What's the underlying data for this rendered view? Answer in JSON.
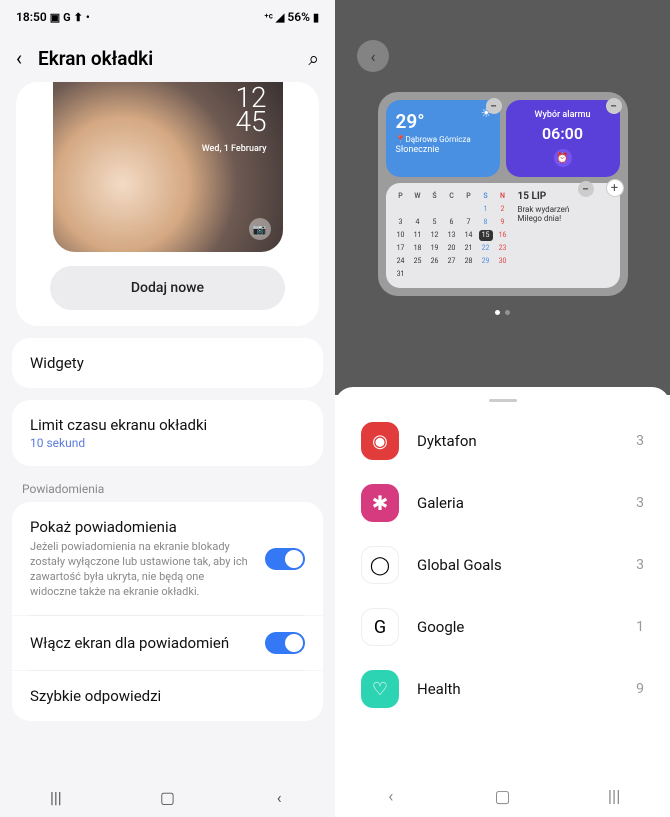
{
  "status": {
    "time": "18:50",
    "icons_left": [
      "G",
      "▲",
      "•"
    ],
    "icons_right": "56%"
  },
  "header": {
    "title": "Ekran okładki"
  },
  "cover": {
    "time1": "12",
    "time2": "45",
    "date": "Wed, 1 February"
  },
  "add_button": "Dodaj nowe",
  "rows": {
    "widgets": "Widgety",
    "timeout_title": "Limit czasu ekranu okładki",
    "timeout_sub": "10 sekund",
    "section": "Powiadomienia",
    "notif_title": "Pokaż powiadomienia",
    "notif_desc": "Jeżeli powiadomienia na ekranie blokady zostały wyłączone lub ustawione tak, aby ich zawartość była ukryta, nie będą one widoczne także na ekranie okładki.",
    "wake_title": "Włącz ekran dla powiadomień",
    "quick_title": "Szybkie odpowiedzi"
  },
  "widgets": {
    "weather": {
      "temp": "29°",
      "loc": "Dąbrowa Górnicza",
      "cond": "Słonecznie"
    },
    "alarm": {
      "title": "Wybór alarmu",
      "time": "06:00"
    },
    "calendar": {
      "headers": [
        "P",
        "W",
        "Ś",
        "C",
        "P",
        "S",
        "N"
      ],
      "days": [
        [
          "",
          "",
          "",
          "",
          "",
          "1",
          "2"
        ],
        [
          "3",
          "4",
          "5",
          "6",
          "7",
          "8",
          "9"
        ],
        [
          "10",
          "11",
          "12",
          "13",
          "14",
          "15",
          "16"
        ],
        [
          "17",
          "18",
          "19",
          "20",
          "21",
          "22",
          "23"
        ],
        [
          "24",
          "25",
          "26",
          "27",
          "28",
          "29",
          "30"
        ],
        [
          "31",
          "",
          "",
          "",
          "",
          "",
          ""
        ]
      ],
      "today": "15",
      "side_date": "15 LIP",
      "side_l1": "Brak wydarzeń",
      "side_l2": "Miłego dnia!"
    }
  },
  "apps": [
    {
      "name": "Dyktafon",
      "count": "3",
      "cls": "i-dyktafon",
      "glyph": "◉"
    },
    {
      "name": "Galeria",
      "count": "3",
      "cls": "i-galeria",
      "glyph": "✱"
    },
    {
      "name": "Global Goals",
      "count": "3",
      "cls": "i-global",
      "glyph": "◯"
    },
    {
      "name": "Google",
      "count": "1",
      "cls": "i-google",
      "glyph": "G"
    },
    {
      "name": "Health",
      "count": "9",
      "cls": "i-health",
      "glyph": "♡"
    }
  ]
}
